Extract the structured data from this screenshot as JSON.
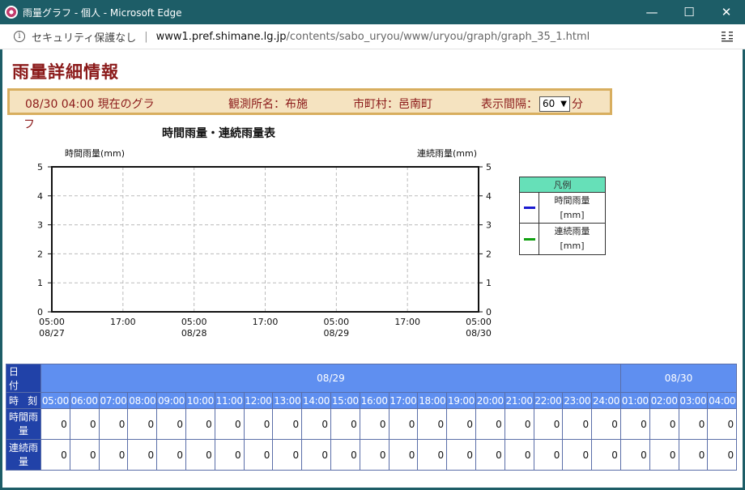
{
  "window": {
    "title": "雨量グラフ - 個人 - Microsoft Edge",
    "controls": {
      "minimize": "—",
      "maximize": "☐",
      "close": "✕"
    }
  },
  "address": {
    "security_label": "セキュリティ保護なし",
    "url_host": "www1.pref.shimane.lg.jp",
    "url_path": "/contents/sabo_uryou/www/uryou/graph/graph_35_1.html"
  },
  "page": {
    "title": "雨量詳細情報",
    "current_time": "08/30 04:00 現在のグラ",
    "current_time_wrap": "フ",
    "station_label": "観測所名：布施",
    "city_label": "市町村：邑南町",
    "interval_label": "表示間隔：",
    "interval_value": "60",
    "interval_unit": "分"
  },
  "chart_data": {
    "type": "line",
    "title": "時間雨量・連続雨量表",
    "ylabel_left": "時間雨量(mm)",
    "ylabel_right": "連続雨量(mm)",
    "ylim": [
      0,
      5
    ],
    "yticks": [
      0,
      1,
      2,
      3,
      4,
      5
    ],
    "x_ticks": [
      {
        "time": "05:00",
        "date": "08/27"
      },
      {
        "time": "17:00",
        "date": ""
      },
      {
        "time": "05:00",
        "date": "08/28"
      },
      {
        "time": "17:00",
        "date": ""
      },
      {
        "time": "05:00",
        "date": "08/29"
      },
      {
        "time": "17:00",
        "date": ""
      },
      {
        "time": "05:00",
        "date": "08/30"
      }
    ],
    "series": [],
    "grid": true
  },
  "legend": {
    "title": "凡例",
    "items": [
      {
        "label_line1": "時間雨量",
        "label_line2": "[mm]",
        "color": "#1a1ad0"
      },
      {
        "label_line1": "連続雨量",
        "label_line2": "[mm]",
        "color": "#10a010"
      }
    ]
  },
  "table": {
    "date_header": "日　付",
    "time_header_1": "時",
    "time_header_2": "刻",
    "dates": [
      {
        "label": "08/29",
        "span": 20
      },
      {
        "label": "08/30",
        "span": 4
      }
    ],
    "times": [
      "05:00",
      "06:00",
      "07:00",
      "08:00",
      "09:00",
      "10:00",
      "11:00",
      "12:00",
      "13:00",
      "14:00",
      "15:00",
      "16:00",
      "17:00",
      "18:00",
      "19:00",
      "20:00",
      "21:00",
      "22:00",
      "23:00",
      "24:00",
      "01:00",
      "02:00",
      "03:00",
      "04:00"
    ],
    "rows": [
      {
        "label1": "時間雨",
        "label2": "量",
        "values": [
          "0",
          "0",
          "0",
          "0",
          "0",
          "0",
          "0",
          "0",
          "0",
          "0",
          "0",
          "0",
          "0",
          "0",
          "0",
          "0",
          "0",
          "0",
          "0",
          "0",
          "0",
          "0",
          "0",
          "0"
        ]
      },
      {
        "label1": "連続雨",
        "label2": "量",
        "values": [
          "0",
          "0",
          "0",
          "0",
          "0",
          "0",
          "0",
          "0",
          "0",
          "0",
          "0",
          "0",
          "0",
          "0",
          "0",
          "0",
          "0",
          "0",
          "0",
          "0",
          "0",
          "0",
          "0",
          "0"
        ]
      }
    ]
  }
}
